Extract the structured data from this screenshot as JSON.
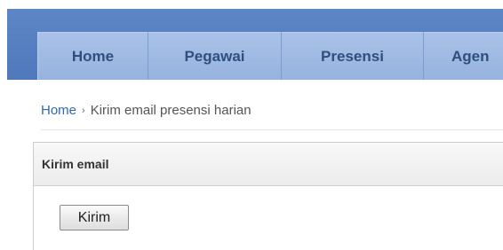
{
  "nav": {
    "tabs": [
      {
        "label": "Home"
      },
      {
        "label": "Pegawai"
      },
      {
        "label": "Presensi"
      },
      {
        "label": "Agen"
      }
    ]
  },
  "breadcrumb": {
    "home_label": "Home",
    "separator": "›",
    "current_label": "Kirim email presensi harian"
  },
  "panel": {
    "title": "Kirim email",
    "send_button_label": "Kirim"
  },
  "colors": {
    "header_blue": "#5c86c6",
    "tab_blue": "#aac2e8",
    "tab_text": "#2f4f7f",
    "link": "#3366aa"
  }
}
